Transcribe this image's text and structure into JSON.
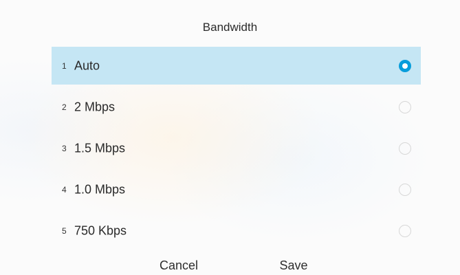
{
  "dialog": {
    "title": "Bandwidth"
  },
  "options": [
    {
      "num": "1",
      "label": "Auto",
      "selected": true
    },
    {
      "num": "2",
      "label": "2 Mbps",
      "selected": false
    },
    {
      "num": "3",
      "label": "1.5 Mbps",
      "selected": false
    },
    {
      "num": "4",
      "label": "1.0 Mbps",
      "selected": false
    },
    {
      "num": "5",
      "label": "750 Kbps",
      "selected": false
    }
  ],
  "footer": {
    "cancel_label": "Cancel",
    "save_label": "Save"
  },
  "colors": {
    "selected_row": "#c5e6f4",
    "radio_accent": "#079ddb"
  }
}
